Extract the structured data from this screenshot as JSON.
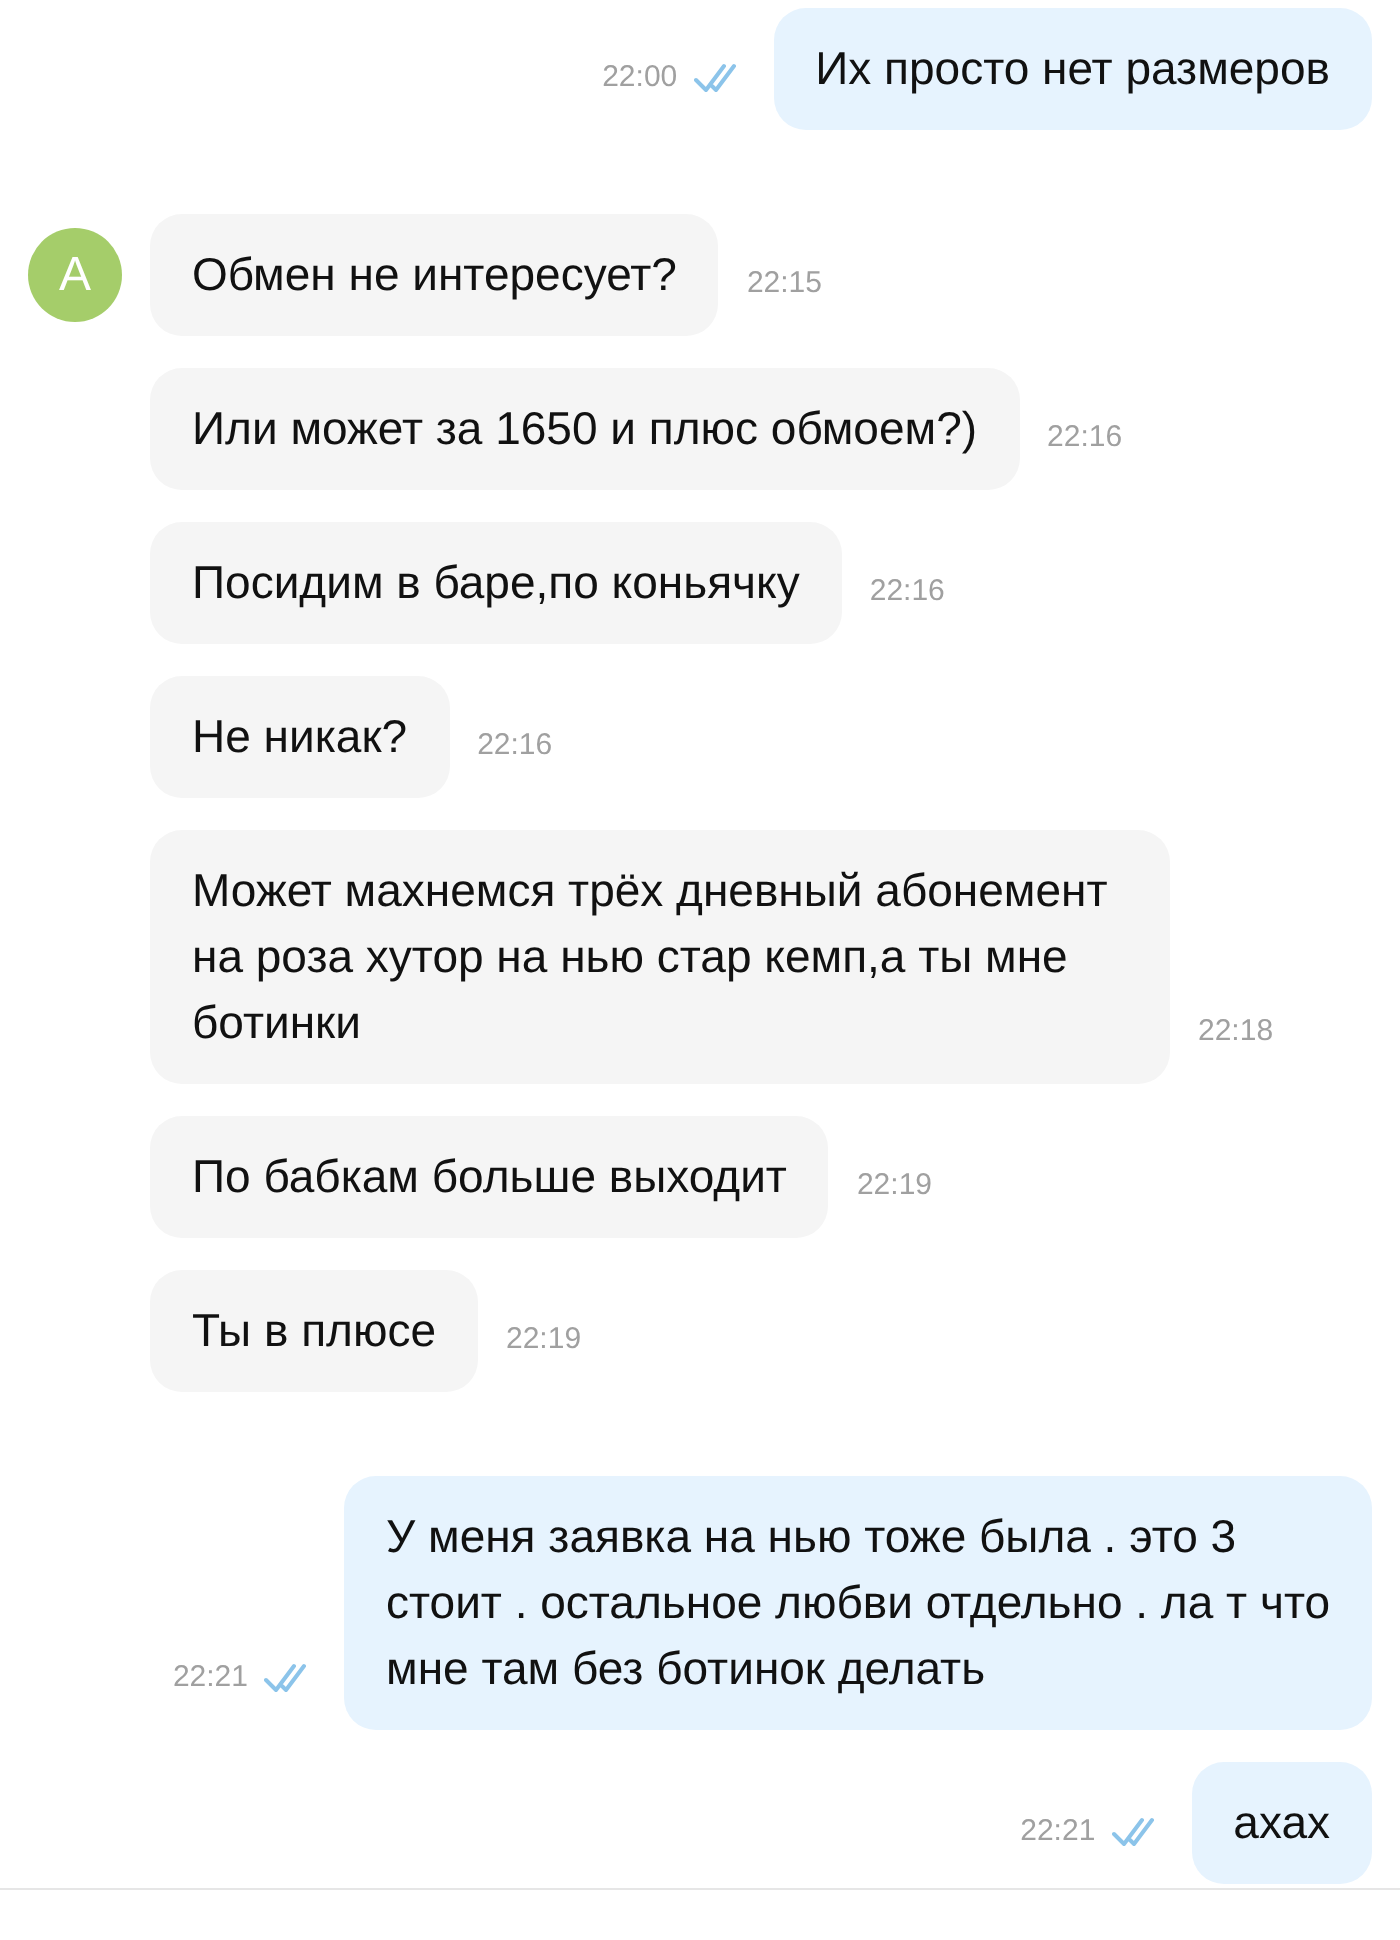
{
  "messages": [
    {
      "kind": "out",
      "text": "Их просто нет размеров",
      "time": "22:00",
      "read": true
    },
    {
      "kind": "in",
      "avatar": "A",
      "text": "Обмен не интересует?",
      "time": "22:15"
    },
    {
      "kind": "in",
      "text": "Или может за 1650 и плюс обмоем?)",
      "time": "22:16"
    },
    {
      "kind": "in",
      "text": "Посидим в баре,по коньячку",
      "time": "22:16"
    },
    {
      "kind": "in",
      "text": "Не никак?",
      "time": "22:16"
    },
    {
      "kind": "in",
      "text": "Может махнемся трёх дневный абонемент на роза хутор на нью стар кемп,а ты мне ботинки",
      "time": "22:18"
    },
    {
      "kind": "in",
      "text": "По бабкам больше выходит",
      "time": "22:19"
    },
    {
      "kind": "in",
      "text": "Ты в плюсе",
      "time": "22:19"
    },
    {
      "kind": "out",
      "text": "У меня заявка на нью тоже была . это 3 стоит . остальное любви отдельно . ла т что мне там без ботинок делать",
      "time": "22:21",
      "read": true
    },
    {
      "kind": "out",
      "text": "ахах",
      "time": "22:21",
      "read": true
    }
  ]
}
